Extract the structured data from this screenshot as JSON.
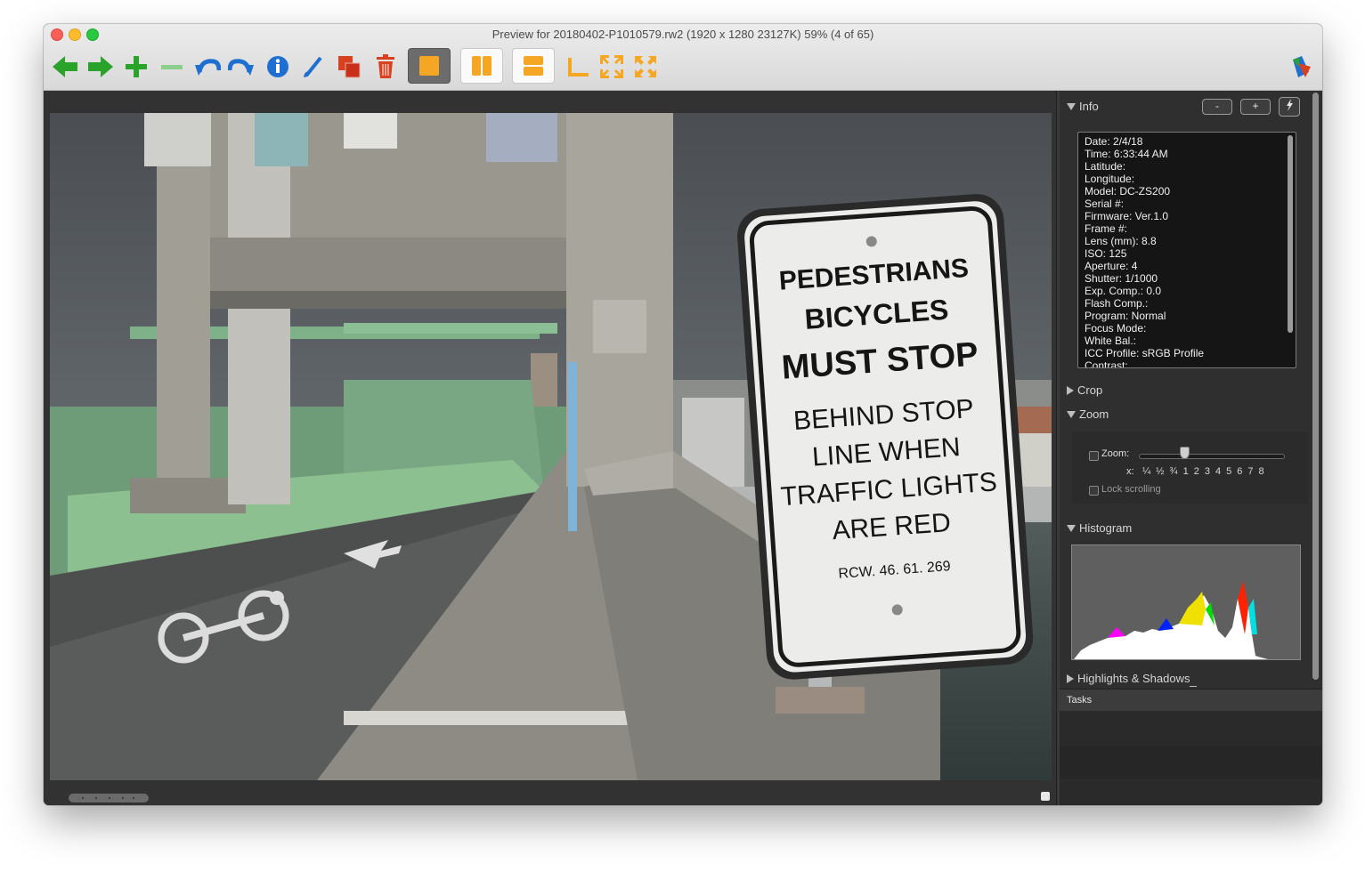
{
  "window": {
    "title": "Preview for 20180402-P1010579.rw2 (1920 x 1280 23127K) 59% (4 of 65)"
  },
  "toolbar": {
    "icons": [
      "arrow-left-icon",
      "arrow-right-icon",
      "plus-icon",
      "minus-icon",
      "undo-icon",
      "redo-icon",
      "info-icon",
      "brush-icon",
      "copy-layers-icon",
      "trash-icon",
      "single-view-icon",
      "split-vertical-icon",
      "split-horizontal-icon",
      "crop-corner-icon",
      "shrink-icon",
      "expand-icon",
      "app-logo-icon"
    ],
    "accent_green": "#2aa32a",
    "accent_orange": "#f5a623",
    "accent_blue": "#1f6fd1",
    "accent_red": "#d9401f"
  },
  "panel": {
    "info": {
      "title": "Info",
      "btn_minus": "-",
      "btn_plus": "+",
      "lines": [
        "Date: 2/4/18",
        "Time: 6:33:44 AM",
        "Latitude:",
        "Longitude:",
        "Model: DC-ZS200",
        "Serial #:",
        "Firmware: Ver.1.0",
        "Frame #:",
        "Lens (mm): 8.8",
        "ISO: 125",
        "Aperture: 4",
        "Shutter: 1/1000",
        "Exp. Comp.: 0.0",
        "Flash Comp.:",
        "Program: Normal",
        "Focus Mode:",
        "White Bal.:",
        "ICC Profile: sRGB Profile",
        "Contrast:"
      ]
    },
    "crop": {
      "title": "Crop"
    },
    "zoom": {
      "title": "Zoom",
      "zoom_label": "Zoom:",
      "x_label": "x:",
      "ticks": [
        "¼",
        "½",
        "¾",
        "1",
        "2",
        "3",
        "4",
        "5",
        "6",
        "7",
        "8"
      ],
      "lock_label": "Lock scrolling"
    },
    "histogram": {
      "title": "Histogram"
    },
    "highlights": {
      "title": "Highlights & Shadows"
    },
    "tasks": {
      "title": "Tasks"
    }
  },
  "photo": {
    "sign_lines": [
      "PEDESTRIANS",
      "BICYCLES",
      "MUST STOP",
      "BEHIND STOP",
      "LINE WHEN",
      "TRAFFIC LIGHTS",
      "ARE RED",
      "RCW. 46. 61. 269"
    ]
  }
}
